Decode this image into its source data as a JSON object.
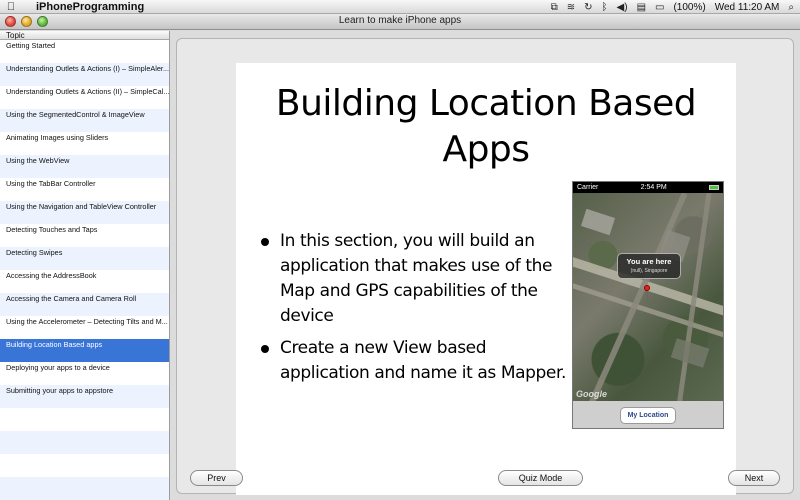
{
  "menubar": {
    "app_name": "iPhoneProgramming",
    "battery": "(100%)",
    "clock": "Wed 11:20 AM"
  },
  "window": {
    "title": "Learn to make iPhone apps"
  },
  "sidebar": {
    "column_header": "Topic",
    "items": [
      "Getting Started",
      "Understanding Outlets & Actions (I) – SimpleAler...",
      "Understanding Outlets & Actions (II) – SimpleCal...",
      "Using the SegmentedControl & ImageView",
      "Animating Images using Sliders",
      "Using the WebView",
      "Using the TabBar Controller",
      "Using the Navigation and TableView Controller",
      "Detecting Touches and Taps",
      "Detecting Swipes",
      "Accessing the AddressBook",
      "Accessing the Camera and Camera Roll",
      "Using the Accelerometer – Detecting Tilts and M...",
      "Building Location Based apps",
      "Deploying your apps to a device",
      "Submitting your apps to appstore"
    ],
    "selected_index": 13
  },
  "slide": {
    "title_line1": "Building Location Based",
    "title_line2": "Apps",
    "bullets": [
      "In this section, you will build an application that makes use of the Map and GPS capabilities of the device",
      "Create a new View based application and name it as Mapper."
    ],
    "phone": {
      "carrier": "Carrier",
      "time": "2:54 PM",
      "callout_title": "You are here",
      "callout_subtitle": "(null), Singapore",
      "button": "My Location",
      "map_logo": "Google"
    }
  },
  "controls": {
    "prev": "Prev",
    "quiz": "Quiz Mode",
    "next": "Next"
  }
}
